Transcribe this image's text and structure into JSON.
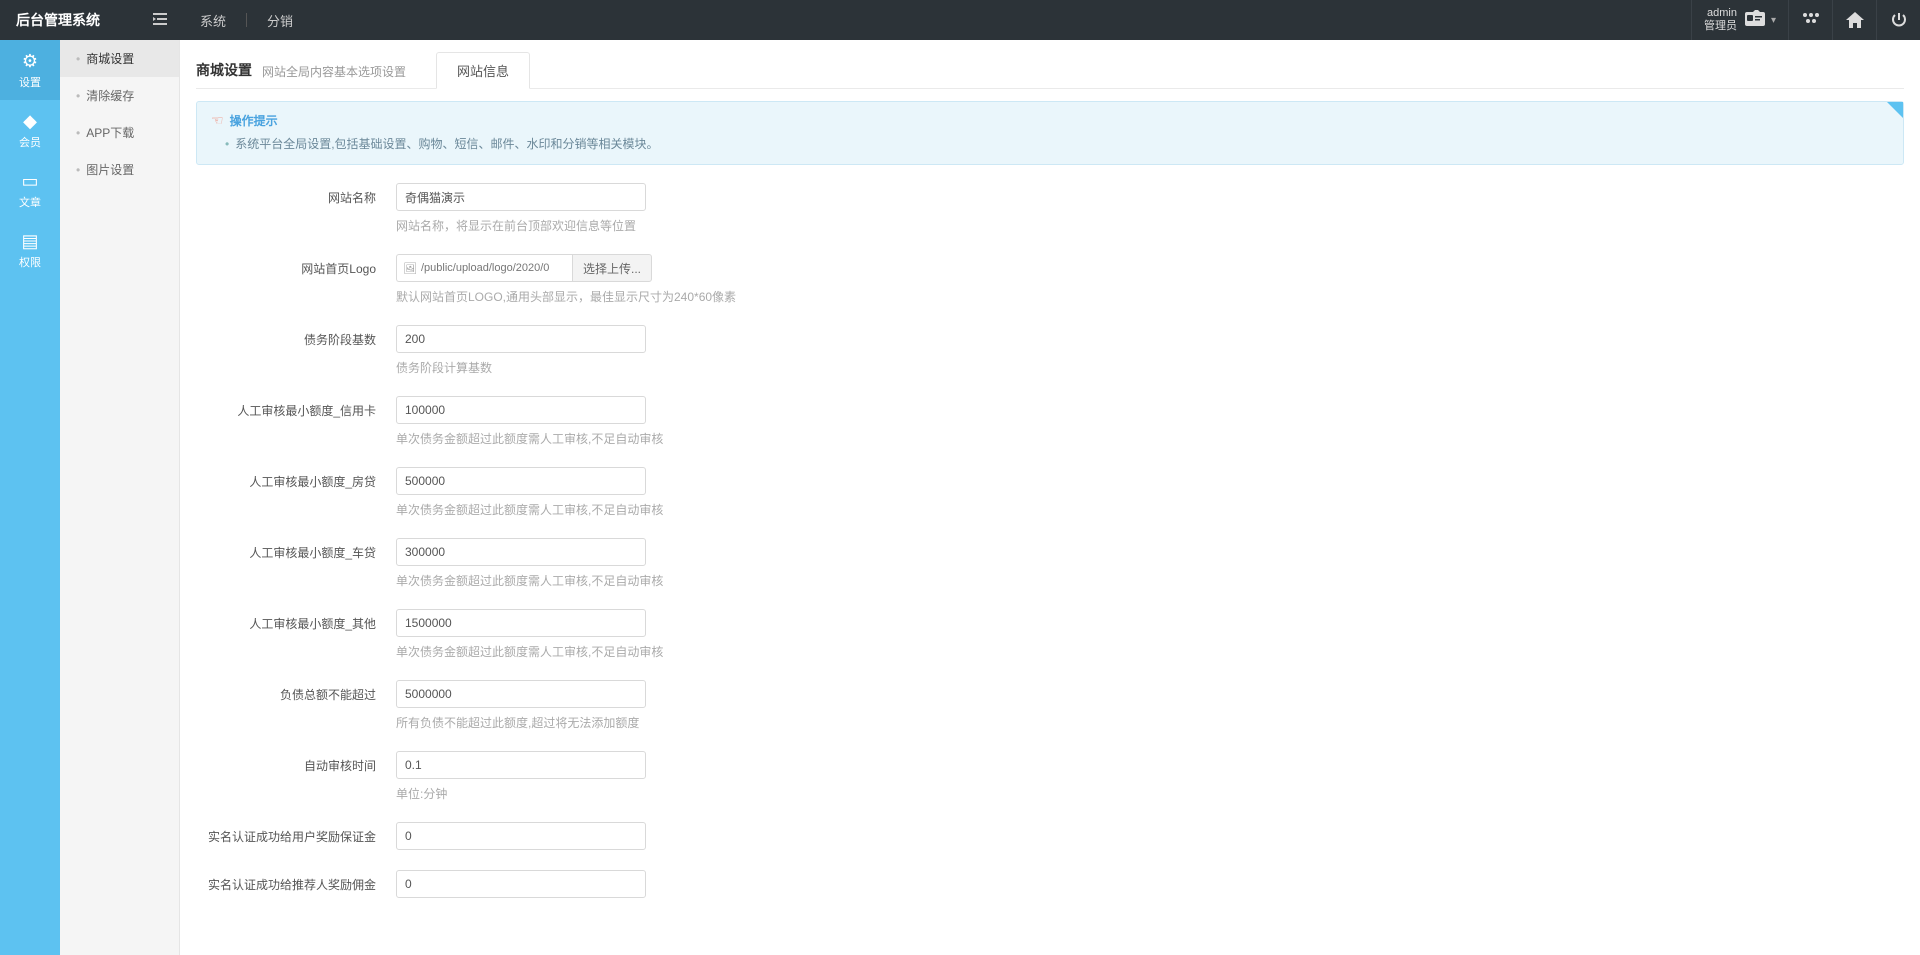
{
  "topbar": {
    "brand": "后台管理系统",
    "menu_toggle_icon": "collapse-icon",
    "nav": {
      "system": "系统",
      "distribution": "分销"
    },
    "user": {
      "name": "admin",
      "role": "管理员"
    }
  },
  "leftbar": {
    "items": [
      {
        "icon": "⚙",
        "label": "设置"
      },
      {
        "icon": "◆",
        "label": "会员"
      },
      {
        "icon": "▭",
        "label": "文章"
      },
      {
        "icon": "▤",
        "label": "权限"
      }
    ]
  },
  "subside": {
    "items": [
      {
        "label": "商城设置",
        "active": true
      },
      {
        "label": "清除缓存",
        "active": false
      },
      {
        "label": "APP下载",
        "active": false
      },
      {
        "label": "图片设置",
        "active": false
      }
    ]
  },
  "page": {
    "title": "商城设置",
    "subtitle": "网站全局内容基本选项设置",
    "tab": {
      "label": "网站信息"
    }
  },
  "tip": {
    "title": "操作提示",
    "items": [
      "系统平台全局设置,包括基础设置、购物、短信、邮件、水印和分销等相关模块。"
    ]
  },
  "form": {
    "fields": [
      {
        "label": "网站名称",
        "value": "奇偶猫演示",
        "hint": "网站名称，将显示在前台顶部欢迎信息等位置",
        "type": "text"
      },
      {
        "label": "网站首页Logo",
        "value": "/public/upload/logo/2020/0",
        "button": "选择上传...",
        "hint": "默认网站首页LOGO,通用头部显示，最佳显示尺寸为240*60像素",
        "type": "logo"
      },
      {
        "label": "债务阶段基数",
        "value": "200",
        "hint": "债务阶段计算基数",
        "type": "text"
      },
      {
        "label": "人工审核最小额度_信用卡",
        "value": "100000",
        "hint": "单次债务金额超过此额度需人工审核,不足自动审核",
        "type": "text"
      },
      {
        "label": "人工审核最小额度_房贷",
        "value": "500000",
        "hint": "单次债务金额超过此额度需人工审核,不足自动审核",
        "type": "text"
      },
      {
        "label": "人工审核最小额度_车贷",
        "value": "300000",
        "hint": "单次债务金额超过此额度需人工审核,不足自动审核",
        "type": "text"
      },
      {
        "label": "人工审核最小额度_其他",
        "value": "1500000",
        "hint": "单次债务金额超过此额度需人工审核,不足自动审核",
        "type": "text"
      },
      {
        "label": "负债总额不能超过",
        "value": "5000000",
        "hint": "所有负债不能超过此额度,超过将无法添加额度",
        "type": "text"
      },
      {
        "label": "自动审核时间",
        "value": "0.1",
        "hint": "单位:分钟",
        "type": "text"
      },
      {
        "label": "实名认证成功给用户奖励保证金",
        "value": "0",
        "hint": "",
        "type": "text"
      },
      {
        "label": "实名认证成功给推荐人奖励佣金",
        "value": "0",
        "hint": "",
        "type": "text"
      }
    ]
  }
}
